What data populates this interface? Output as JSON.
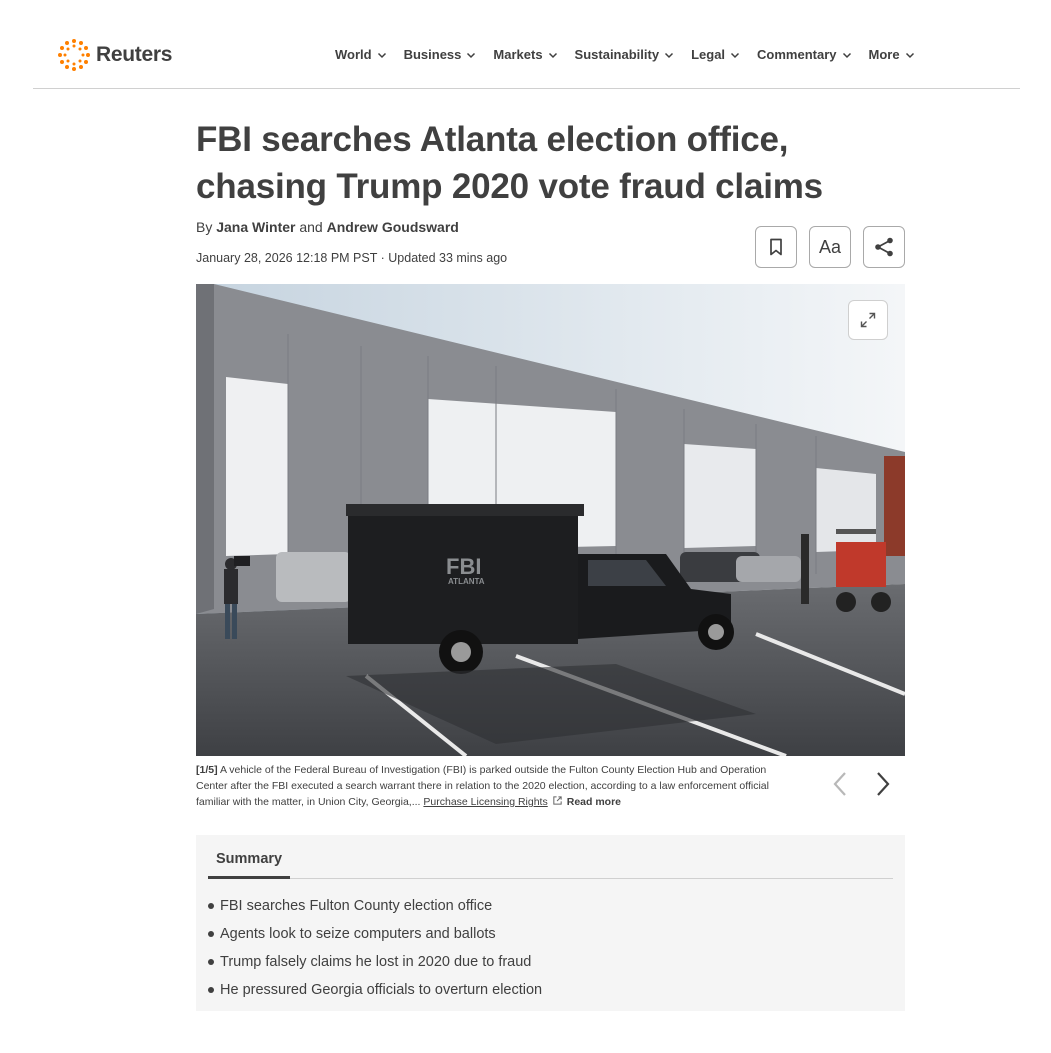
{
  "brand": {
    "name": "Reuters",
    "accent": "#ff8000"
  },
  "nav": {
    "items": [
      {
        "label": "World"
      },
      {
        "label": "Business"
      },
      {
        "label": "Markets"
      },
      {
        "label": "Sustainability"
      },
      {
        "label": "Legal"
      },
      {
        "label": "Commentary"
      },
      {
        "label": "More"
      }
    ]
  },
  "article": {
    "headline": "FBI searches Atlanta election office, chasing Trump 2020 vote fraud claims",
    "byline_prefix": "By",
    "author1": "Jana Winter",
    "byline_and": "and",
    "author2": "Andrew Goudsward",
    "date": "January 28, 2026 12:18 PM PST",
    "updated": "Updated 33 mins ago"
  },
  "tools": {
    "font_label": "Aa"
  },
  "photo": {
    "truck_text": "FBI",
    "truck_subtext": "ATLANTA",
    "index": "[1/5]",
    "caption": "A vehicle of the Federal Bureau of Investigation (FBI) is parked outside the Fulton County Election Hub and Operation Center after the FBI executed a search warrant there in relation to the 2020 election, according to a law enforcement official familiar with the matter, in Union City, Georgia,...",
    "licensing": "Purchase Licensing Rights",
    "read_more": "Read more"
  },
  "summary": {
    "tab": "Summary",
    "items": [
      "FBI searches Fulton County election office",
      "Agents look to seize computers and ballots",
      "Trump falsely claims he lost in 2020 due to fraud",
      "He pressured Georgia officials to overturn election"
    ]
  }
}
